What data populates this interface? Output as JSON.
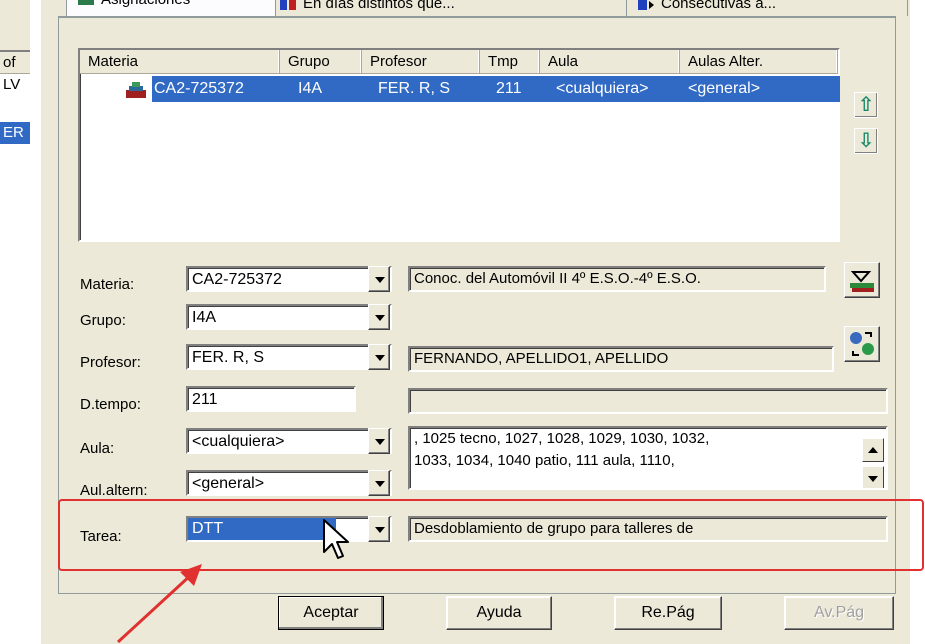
{
  "left_list": {
    "header": "of",
    "items": [
      "LV",
      "ER"
    ]
  },
  "tabs": [
    {
      "label": "Asignaciones"
    },
    {
      "label": "En días distintos que..."
    },
    {
      "label": "Consecutivas a..."
    }
  ],
  "listview": {
    "columns": [
      "Materia",
      "Grupo",
      "Profesor",
      "Tmp",
      "Aula",
      "Aulas Alter."
    ],
    "rows": [
      {
        "materia": "CA2-725372",
        "grupo": "I4A",
        "profesor": "FER. R, S",
        "tmp": "211",
        "aula": "<cualquiera>",
        "aulas_alter": "<general>"
      }
    ]
  },
  "side_arrows": {
    "up": "⇧",
    "down": "⇩"
  },
  "form": {
    "materia": {
      "label": "Materia:",
      "value": "CA2-725372",
      "description": "Conoc. del Automóvil II 4º E.S.O.-4º E.S.O."
    },
    "grupo": {
      "label": "Grupo:",
      "value": "I4A"
    },
    "profesor": {
      "label": "Profesor:",
      "value": "FER. R, S",
      "description": "FERNANDO,  APELLIDO1,  APELLIDO"
    },
    "dtempo": {
      "label": "D.tempo:",
      "value": "211",
      "description": ""
    },
    "aula": {
      "label": "Aula:",
      "value": "<cualquiera>",
      "rooms_line1": ", 1025 tecno, 1027, 1028, 1029, 1030, 1032,",
      "rooms_line2": "1033, 1034, 1040 patio, 111 aula, 1110,"
    },
    "aul_altern": {
      "label": "Aul.altern:",
      "value": "<general>"
    },
    "tarea": {
      "label": "Tarea:",
      "value": "DTT",
      "description": "Desdoblamiento de grupo para talleres de"
    }
  },
  "buttons": {
    "aceptar": "Aceptar",
    "ayuda": "Ayuda",
    "re_pag": "Re.Pág",
    "av_pag": "Av.Pág"
  },
  "colors": {
    "selection": "#316ac5",
    "highlight_annotation": "#e03030",
    "dialog_bg": "#ece9d8"
  }
}
